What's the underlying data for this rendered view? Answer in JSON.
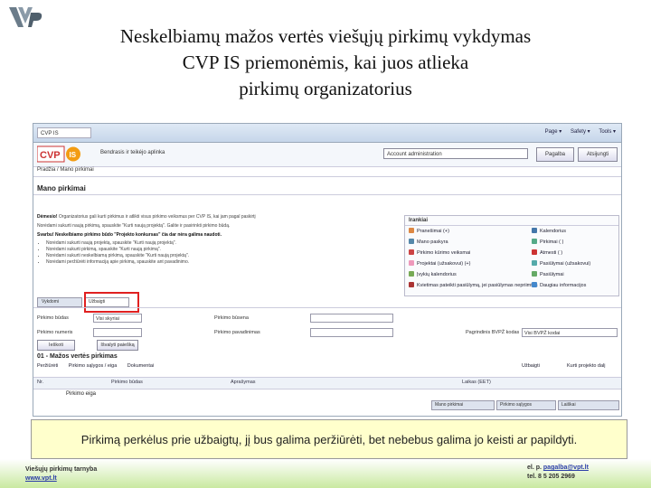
{
  "slide": {
    "title_lines": [
      "Neskelbiamų mažos vertės viešųjų pirkimų vykdymas",
      "CVP IS priemonėmis, kai juos atlieka",
      "pirkimų organizatorius"
    ],
    "caption": "Pirkimą perkėlus prie užbaigtų, jį bus galima peržiūrėti, bet nebebus galima jo keisti ar papildyti."
  },
  "footer": {
    "org": "Viešųjų pirkimų tarnyba",
    "site": "www.vpt.lt",
    "email_prefix": "el. p.",
    "email": "pagalba@vpt.lt",
    "phone": "tel. 8 5 205 2969"
  },
  "browser": {
    "tab": "CVP IS",
    "tools": [
      "Page ▾",
      "Safety ▾",
      "Tools ▾"
    ]
  },
  "app": {
    "header_title": "Bendrasis ir teikėjo aplinka",
    "account": "Account administration",
    "header_buttons": [
      "Pagalba",
      "Atsijungti"
    ],
    "breadcrumb": "Pradžia / Mano pirkimai",
    "page_title": "Mano pirkimai",
    "notice_attention": "Dėmesio!",
    "notice_text_1": "Organizatorius gali kurti pirkimus ir atlikti visus pirkimo veiksmus per CVP IS, kai jam pagal paskirtį",
    "notice_text_2": "Norėdami sukurti naują pirkimą, spauskite \"Kurti naują projektą\". Galite ir pasirinkti pirkimo būdą.",
    "notice_bold": "Svarbu! Neskelbiamo pirkimo būdo \"Projekto konkursas\" čia dar nėra galima naudoti.",
    "notice_items": [
      "Norėdami sukurti naują projektą, spauskite \"Kurti naują projektą\".",
      "Norėdami sukurti pirkimą, spauskite \"Kurti naują pirkimą\".",
      "Norėdami sukurti neskelbiamą pirkimą, spauskite \"Kurti naują projektą\".",
      "Norėdami peržiūrėti informaciją apie pirkimą, spauskite ant pavadinimo."
    ],
    "tools": {
      "heading": "Irankiai",
      "items_left": [
        "Pranešimai (+)",
        "Mano paskyra",
        "Pirkimo kūrimo veiksmai",
        "Projektai (užsakovui) (+)",
        "Įvykių kalendorius",
        "Kvietimas pateikti pasiūlymą, jei pasiūlymas nepriimtas"
      ],
      "items_right": [
        "Kalendorius",
        "Pirkimai ( )",
        "Atmesti ( )",
        "Pasiūlymai (užsakovui)",
        "Pasiūlymai",
        "Daugiau informacijos"
      ]
    },
    "filter_tabs": [
      "Vykdomi",
      "Užbaigti"
    ],
    "filters": {
      "type_label": "Pirkimo būdas",
      "type_value": "Visi skyriai",
      "no_label": "Pirkimo numeris",
      "name_label": "Pirkimo pavadinimas",
      "status_label": "Pirkimo būsena",
      "cpv_label": "Pagrindinis BVPŽ kodas",
      "cpv_value": "Visi BVPŽ kodai",
      "search_btn": "Ieškoti",
      "clear_btn": "Išvalyti paiešką"
    },
    "section_title": "01 - Mažos vertės pirkimas",
    "actions": [
      "Peržiūrėti",
      "Pirkimo sąlygos / eiga",
      "Dokumentai"
    ],
    "right_actions": [
      "Užbaigti",
      "Kurti projekto dalį"
    ],
    "table_headers": [
      "Nr.",
      "Pirkimo būdas",
      "Aprašymas",
      "Laikas (EET)"
    ],
    "table_row": "Pirkimo eiga",
    "bottom_tabs": [
      "Mano pirkimai",
      "Pirkimo sąlygos",
      "Laiškai"
    ]
  }
}
